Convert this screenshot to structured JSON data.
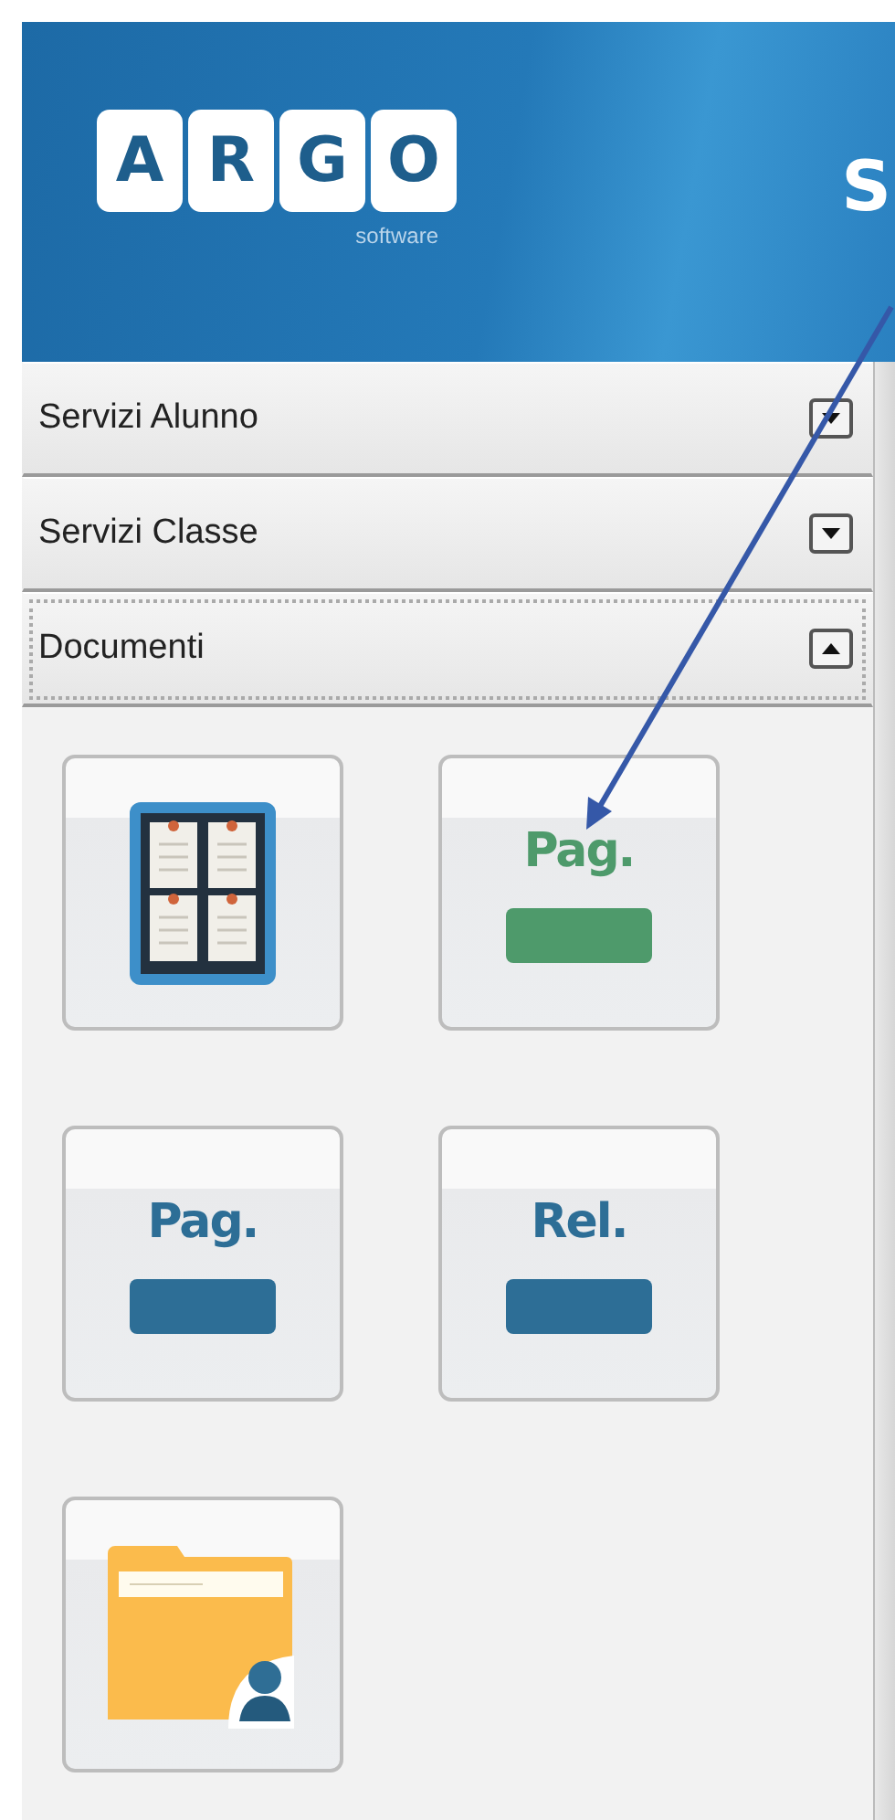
{
  "header": {
    "logo_letters": [
      "A",
      "R",
      "G",
      "O"
    ],
    "logo_subtitle": "software",
    "title_fragment": "S"
  },
  "sections": [
    {
      "title": "Servizi Alunno",
      "expanded": false,
      "focused": false
    },
    {
      "title": "Servizi Classe",
      "expanded": false,
      "focused": false
    },
    {
      "title": "Documenti",
      "expanded": true,
      "focused": true
    }
  ],
  "tiles": [
    {
      "kind": "board"
    },
    {
      "kind": "document",
      "label": "Pag.",
      "color": "#4e9a6b"
    },
    {
      "kind": "document",
      "label": "Pag.",
      "color": "#2d6e96"
    },
    {
      "kind": "document",
      "label": "Rel.",
      "color": "#2d6e96"
    },
    {
      "kind": "folder"
    }
  ],
  "annotation": {
    "kind": "arrow"
  }
}
